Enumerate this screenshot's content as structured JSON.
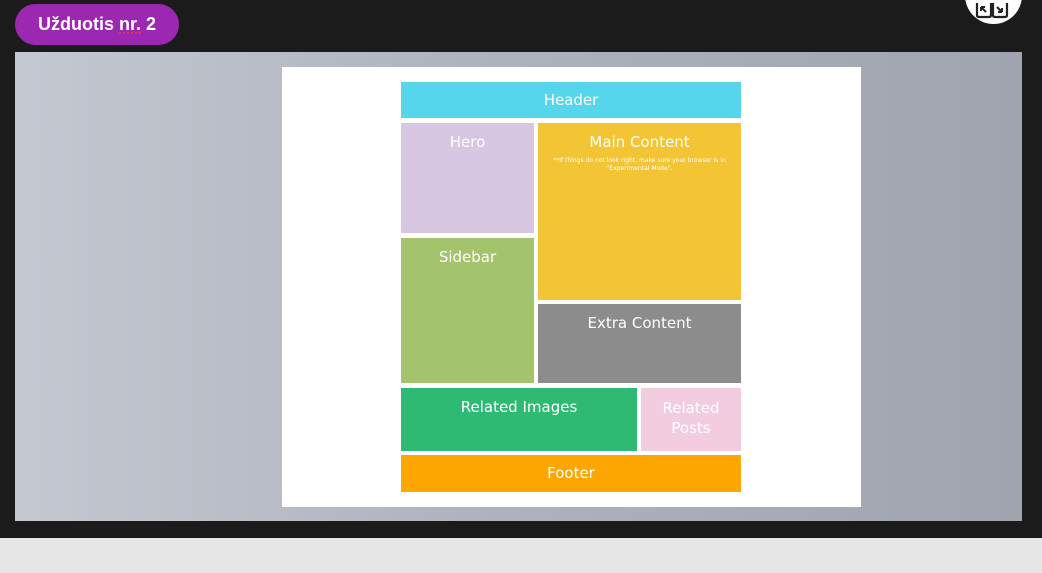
{
  "task_badge": {
    "prefix": "Užduotis ",
    "underlined": "nr.",
    "suffix": " 2"
  },
  "corner_button": {
    "icon": "expand-icon"
  },
  "layout_image": {
    "header": "Header",
    "hero": "Hero",
    "main_content": "Main Content",
    "main_note": "**If things do not look right, make sure your browser is in \"Experimental Mode\".",
    "sidebar": "Sidebar",
    "extra_content": "Extra Content",
    "related_images": "Related Images",
    "related_posts": "Related Posts",
    "footer": "Footer"
  },
  "colors": {
    "badge": "#9c27b0",
    "header": "#55d6ec",
    "hero": "#d8c7e3",
    "main": "#f3c433",
    "sidebar": "#a3c46d",
    "extra": "#8c8c8c",
    "related_images": "#2eba72",
    "related_posts": "#f2cde0",
    "footer": "#fea602"
  }
}
